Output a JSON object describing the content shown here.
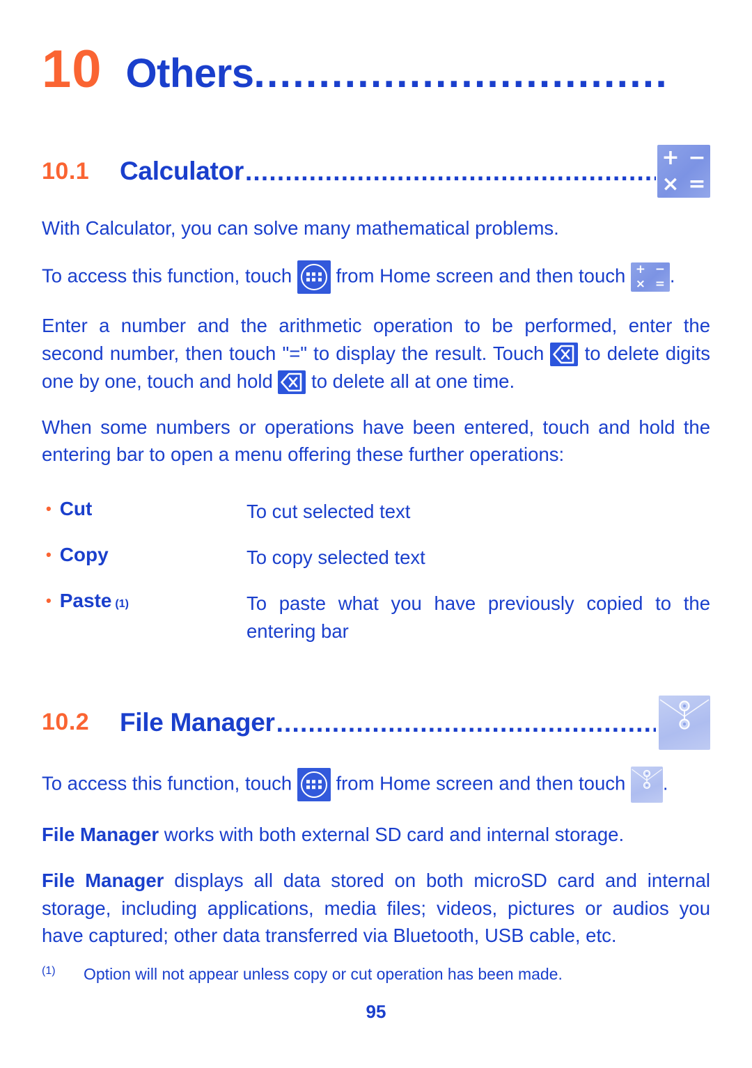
{
  "colors": {
    "accent_orange": "#FA6432",
    "body_blue": "#1A3FCC",
    "icon_blue": "#3259DB",
    "icon_periwinkle": "#8EA3E8",
    "icon_light_periwinkle": "#BFCBF3"
  },
  "chapter": {
    "number": "10",
    "title": "Others",
    "leader": "................................"
  },
  "sections": [
    {
      "number": "10.1",
      "title": "Calculator",
      "leader": "........................................................",
      "icon": "calculator-icon"
    },
    {
      "number": "10.2",
      "title": "File Manager",
      "leader": ".................................................",
      "icon": "file-manager-icon"
    }
  ],
  "calculator": {
    "intro": "With Calculator, you can solve many mathematical problems.",
    "access_part1": "To access this function, touch",
    "access_part2": "from Home screen and then touch",
    "access_part3": ".",
    "operation_part1": "Enter a number and the arithmetic operation to be performed, enter the second number, then touch \"=\" to display the result. Touch",
    "operation_part2": "to delete digits one by one, touch and hold",
    "operation_part3": "to delete all at one time.",
    "menu_intro": "When some numbers or operations have been entered, touch and hold the entering bar to open a menu offering these further operations:",
    "options": [
      {
        "term": "Cut",
        "footnote": "",
        "description": "To cut selected text"
      },
      {
        "term": "Copy",
        "footnote": "",
        "description": "To copy selected text"
      },
      {
        "term": "Paste",
        "footnote": "(1)",
        "description": "To paste what you have previously copied to the entering bar"
      }
    ]
  },
  "file_manager": {
    "access_part1": "To access this function, touch",
    "access_part2": "from Home screen and then touch",
    "access_part3": ".",
    "works_bold": "File Manager",
    "works_rest": " works with both external SD card and internal storage.",
    "displays_bold": "File Manager",
    "displays_rest": " displays all data stored on both microSD card and internal storage, including applications, media files; videos, pictures or audios you have captured; other data transferred via Bluetooth, USB cable, etc."
  },
  "footnote": {
    "mark": "(1)",
    "text": "Option will not appear unless copy or cut operation has been made."
  },
  "page_number": "95",
  "icon_glyphs": {
    "calc_plus": "+",
    "calc_minus": "−",
    "calc_times": "×",
    "calc_equals": "="
  }
}
